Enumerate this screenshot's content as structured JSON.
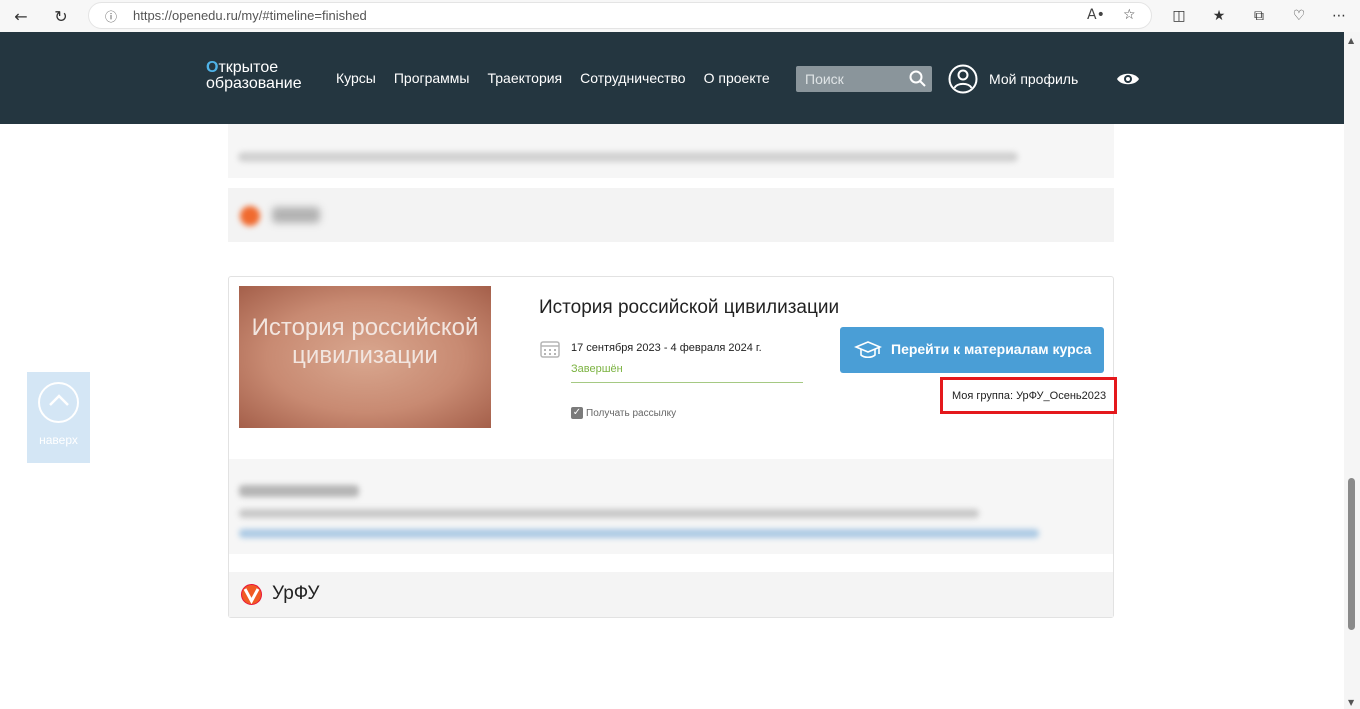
{
  "browser": {
    "url": "https://openedu.ru/my/#timeline=finished"
  },
  "header": {
    "logo_line1": "ткрытое",
    "logo_o": "О",
    "logo_line2": "образование",
    "nav": [
      "Курсы",
      "Программы",
      "Траектория",
      "Сотрудничество",
      "О проекте"
    ],
    "search_placeholder": "Поиск",
    "profile_label": "Мой профиль"
  },
  "to_top_label": "наверх",
  "course": {
    "image_title": "История российской цивилизации",
    "title": "История российской цивилизации",
    "dates": "17 сентября 2023 - 4 февраля 2024 г.",
    "status": "Завершён",
    "newsletter_label": "Получать рассылку",
    "newsletter_checked": true,
    "go_button_label": "Перейти к материалам курса",
    "group_text": "Моя группа: УрФУ_Осень2023",
    "org_name": "УрФУ"
  },
  "colors": {
    "header_bg": "#243640",
    "accent": "#4a9ed6",
    "status_green": "#7cb342",
    "highlight_red": "#e4181c"
  }
}
